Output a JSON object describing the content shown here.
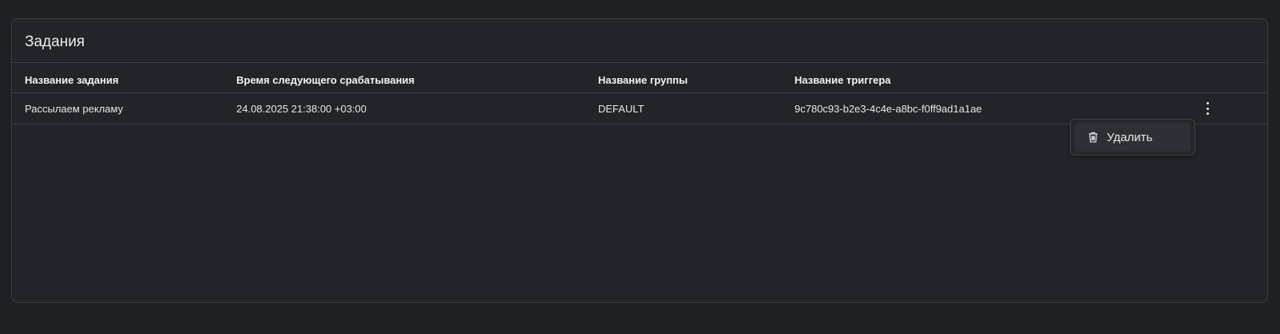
{
  "card": {
    "title": "Задания"
  },
  "table": {
    "columns": [
      "Название задания",
      "Время следующего срабатывания",
      "Название группы",
      "Название триггера"
    ],
    "rows": [
      {
        "job_name": "Рассылаем рекламу",
        "next_fire_time": "24.08.2025 21:38:00 +03:00",
        "group_name": "DEFAULT",
        "trigger_name": "9c780c93-b2e3-4c4e-a8bc-f0ff9ad1a1ae"
      }
    ]
  },
  "row_actions": {
    "icon": "more-vertical-icon",
    "menu": {
      "items": [
        {
          "label": "Удалить",
          "icon": "trash-icon"
        }
      ]
    }
  }
}
